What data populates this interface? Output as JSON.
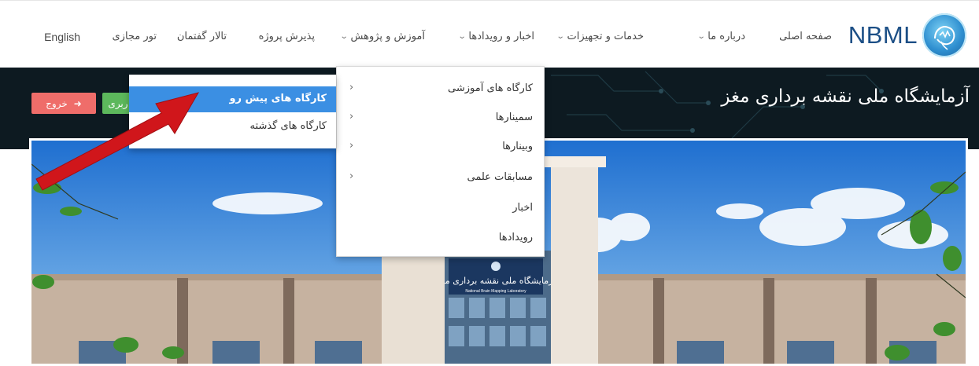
{
  "logo": {
    "text": "NBML",
    "badge": "NBML"
  },
  "nav": {
    "home": "صفحه اصلی",
    "about": "درباره ما",
    "services": "خدمات و تجهیزات",
    "news": "اخبار و رویدادها",
    "education": "آموزش و پژوهش",
    "project": "پذیرش پروژه",
    "forum": "تالار گفتمان",
    "tour": "تور مجازی",
    "english": "English"
  },
  "banner": {
    "title": "آزمایشگاه ملی نقشه برداری مغز",
    "exit_label": "خروج",
    "user_label": "ربری"
  },
  "education_menu": {
    "items": [
      {
        "label": "کارگاه های آموزشی",
        "has_submenu": true
      },
      {
        "label": "سمینارها",
        "has_submenu": true
      },
      {
        "label": "وبینارها",
        "has_submenu": true
      },
      {
        "label": "مسابقات علمی",
        "has_submenu": true
      },
      {
        "label": "اخبار",
        "has_submenu": false
      },
      {
        "label": "رویدادها",
        "has_submenu": false
      }
    ]
  },
  "workshop_submenu": {
    "items": [
      {
        "label": "کارگاه های پیش رو",
        "active": true
      },
      {
        "label": "کارگاه های گذشته",
        "active": false
      }
    ]
  },
  "building_sign": {
    "line1": "آزمایشگاه ملی نقشه برداری مغز",
    "line2": "National Brain Mapping Laboratory"
  },
  "colors": {
    "accent_blue": "#3b8fe3",
    "exit_red": "#ef6d6a",
    "user_green": "#5cb85c",
    "arrow_red": "#d0161b",
    "banner_dark": "#0d1a21"
  }
}
